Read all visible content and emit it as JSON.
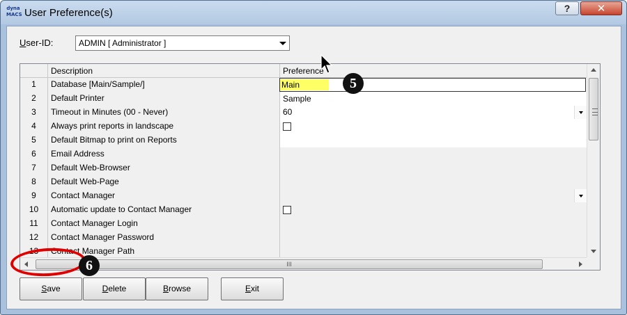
{
  "window": {
    "title": "User Preference(s)",
    "logo_line1": "dyna",
    "logo_line2": "MACS",
    "help_label": "?",
    "close_label": "✕"
  },
  "user": {
    "label_prefix": "U",
    "label_rest": "ser-ID:",
    "selected_value": "ADMIN [ Administrator ]"
  },
  "grid": {
    "headers": {
      "number": "",
      "description": "Description",
      "preference": "Preference"
    },
    "rows": [
      {
        "num": "1",
        "description": "Database [Main/Sample/]",
        "preference": "",
        "type": "dropdown"
      },
      {
        "num": "2",
        "description": "Default Printer",
        "preference": "",
        "type": "text"
      },
      {
        "num": "3",
        "description": "Timeout in Minutes (00 - Never)",
        "preference": "60",
        "type": "dropdown"
      },
      {
        "num": "4",
        "description": "Always print reports in landscape",
        "preference": "",
        "type": "checkbox",
        "checked": false
      },
      {
        "num": "5",
        "description": "Default Bitmap to print on Reports",
        "preference": "",
        "type": "text"
      },
      {
        "num": "6",
        "description": "Email Address",
        "preference": "",
        "type": "text"
      },
      {
        "num": "7",
        "description": "Default Web-Browser",
        "preference": "",
        "type": "text"
      },
      {
        "num": "8",
        "description": "Default Web-Page",
        "preference": "",
        "type": "text"
      },
      {
        "num": "9",
        "description": "Contact Manager",
        "preference": "",
        "type": "dropdown"
      },
      {
        "num": "10",
        "description": "Automatic update to Contact Manager",
        "preference": "",
        "type": "checkbox",
        "checked": false
      },
      {
        "num": "11",
        "description": "Contact Manager Login",
        "preference": "",
        "type": "text"
      },
      {
        "num": "12",
        "description": "Contact Manager Password",
        "preference": "",
        "type": "text"
      },
      {
        "num": "13",
        "description": "Contact Manager Path",
        "preference": "",
        "type": "text"
      }
    ],
    "database_dropdown": {
      "options": [
        "Main",
        "Sample"
      ],
      "highlighted": "Main"
    },
    "hscroll_grip": "III"
  },
  "buttons": {
    "save": {
      "mnemonic": "S",
      "rest": "ave"
    },
    "delete": {
      "mnemonic": "D",
      "rest": "elete"
    },
    "browse": {
      "mnemonic": "B",
      "rest": "rowse"
    },
    "exit": {
      "mnemonic": "E",
      "rest": "xit"
    }
  },
  "annotations": {
    "step5": "5",
    "step6": "6"
  },
  "colors": {
    "highlight": "#ffff66",
    "annotation_ring": "#e00000",
    "title_bar": "#b3c9e3"
  }
}
